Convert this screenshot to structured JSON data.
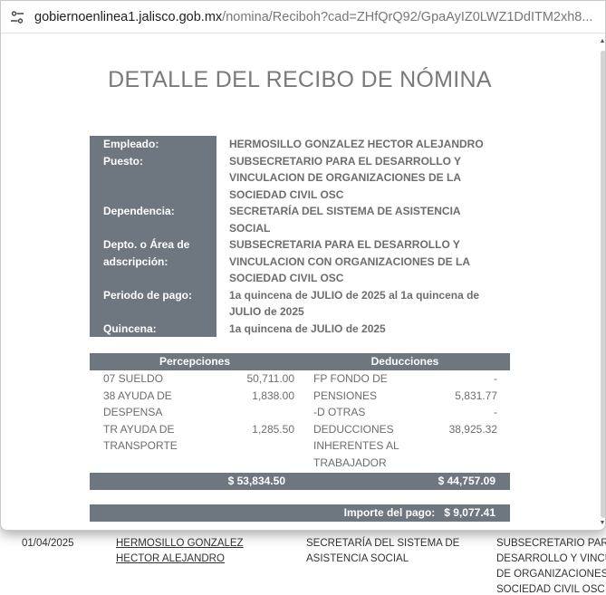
{
  "browser": {
    "url_host": "gobiernoenlinea1.jalisco.gob.mx",
    "url_path": "/nomina/Reciboh?cad=ZHfQrQ92/GpaAyIZ0LWZ1DdITM2xh8..."
  },
  "receipt": {
    "title": "DETALLE DEL RECIBO DE NÓMINA",
    "info": [
      {
        "label": "Empleado:",
        "value": "HERMOSILLO GONZALEZ HECTOR ALEJANDRO"
      },
      {
        "label": "Puesto:",
        "value": "SUBSECRETARIO PARA EL DESARROLLO Y VINCULACION DE ORGANIZACIONES DE LA SOCIEDAD CIVIL OSC"
      },
      {
        "label": "Dependencia:",
        "value": "SECRETARÍA DEL SISTEMA DE ASISTENCIA SOCIAL"
      },
      {
        "label": "Depto. o Área de adscripción:",
        "value": "SUBSECRETARIA PARA EL DESARROLLO Y VINCULACION CON ORGANIZACIONES DE LA SOCIEDAD CIVIL OSC"
      },
      {
        "label": "Periodo de pago:",
        "value": "1a quincena de JULIO de 2025 al  1a quincena de JULIO de 2025"
      },
      {
        "label": "Quincena:",
        "value": "1a quincena de JULIO de 2025"
      }
    ],
    "percepciones_header": "Percepciones",
    "deducciones_header": "Deducciones",
    "percepciones": [
      {
        "concept": "07 SUELDO",
        "amount": "50,711.00"
      },
      {
        "concept": "38 AYUDA DE DESPENSA",
        "amount": "1,838.00"
      },
      {
        "concept": "TR AYUDA DE TRANSPORTE",
        "amount": "1,285.50"
      }
    ],
    "deducciones": [
      {
        "concept": "FP FONDO DE PENSIONES",
        "amount": "-",
        "amount2": "5,831.77"
      },
      {
        "concept": "-D OTRAS DEDUCCIONES INHERENTES AL TRABAJADOR",
        "amount": "-",
        "amount2": "38,925.32"
      }
    ],
    "total_percepciones": "$ 53,834.50",
    "total_deducciones": "$ 44,757.09",
    "importe_label": "Importe del pago:",
    "importe_value": "$ 9,077.41"
  },
  "background_row": {
    "date": "01/04/2025",
    "name": "HERMOSILLO GONZALEZ HECTOR ALEJANDRO",
    "dependencia": "SECRETARÍA DEL SISTEMA DE ASISTENCIA SOCIAL",
    "puesto": "SUBSECRETARIO PARA EL DESARROLLO Y VINCULACION DE ORGANIZACIONES DE LA SOCIEDAD CIVIL OSC"
  },
  "icons": {
    "site_info": "tune-icon"
  }
}
